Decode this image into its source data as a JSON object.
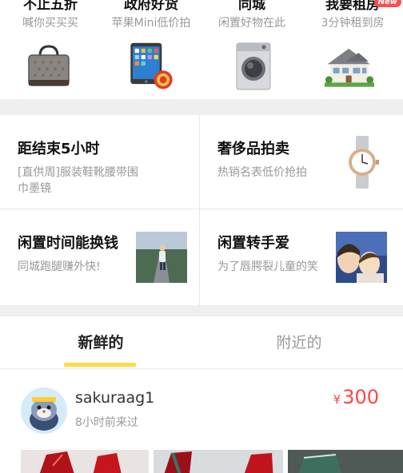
{
  "categories": [
    {
      "title": "不止五折",
      "subtitle": "喊你买买买",
      "icon": "handbag-icon"
    },
    {
      "title": "政府好货",
      "subtitle": "苹果Mini低价拍",
      "icon": "ipad-icon"
    },
    {
      "title": "同城",
      "subtitle": "闲置好物在此",
      "icon": "washing-machine-icon"
    },
    {
      "title": "我要租房",
      "subtitle": "3分钟租到房",
      "icon": "house-icon",
      "badge": "New"
    }
  ],
  "promos": [
    {
      "title": "距结束5小时",
      "description": "[直供周]服装鞋靴腰带围巾墨镜"
    },
    {
      "title": "奢侈品拍卖",
      "description": "热销名表低价抢拍",
      "icon": "watch-icon"
    },
    {
      "title": "闲置时间能换钱",
      "description": "同城跑腿赚外快!",
      "icon": "runner-photo"
    },
    {
      "title": "闲置转手爱",
      "description": "为了唇腭裂儿童的笑",
      "icon": "child-photo"
    }
  ],
  "tabs": {
    "fresh": "新鲜的",
    "nearby": "附近的",
    "active": "fresh"
  },
  "listing": {
    "username": "sakuraag1",
    "last_seen": "8小时前来过",
    "currency": "¥",
    "price": "300"
  },
  "colors": {
    "accent_yellow": "#ffda44",
    "price_red": "#ff4444",
    "divider": "#efefef",
    "new_badge": "#ff4d4d"
  }
}
